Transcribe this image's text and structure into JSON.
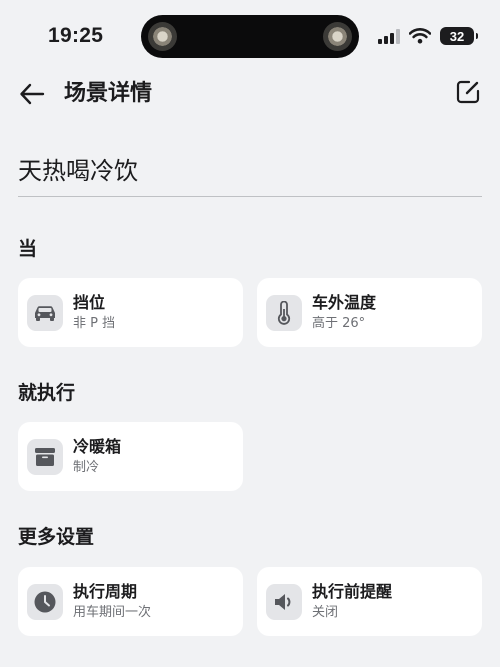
{
  "status_bar": {
    "time": "19:25",
    "battery": "32"
  },
  "header": {
    "title": "场景详情"
  },
  "scene": {
    "name": "天热喝冷饮"
  },
  "sections": {
    "when": {
      "title": "当",
      "cards": [
        {
          "label": "挡位",
          "value": "非 P 挡",
          "icon": "car-icon"
        },
        {
          "label": "车外温度",
          "value": "高于 26°",
          "icon": "thermometer-icon"
        }
      ]
    },
    "then": {
      "title": "就执行",
      "cards": [
        {
          "label": "冷暖箱",
          "value": "制冷",
          "icon": "cooler-box-icon"
        }
      ]
    },
    "more": {
      "title": "更多设置",
      "cards": [
        {
          "label": "执行周期",
          "value": "用车期间一次",
          "icon": "clock-icon"
        },
        {
          "label": "执行前提醒",
          "value": "关闭",
          "icon": "speaker-icon"
        }
      ]
    }
  },
  "colors": {
    "background": "#f1f2f4",
    "card": "#ffffff",
    "icon_bg": "#e4e5e8",
    "icon": "#55575c",
    "secondary_text": "#6e7075"
  }
}
